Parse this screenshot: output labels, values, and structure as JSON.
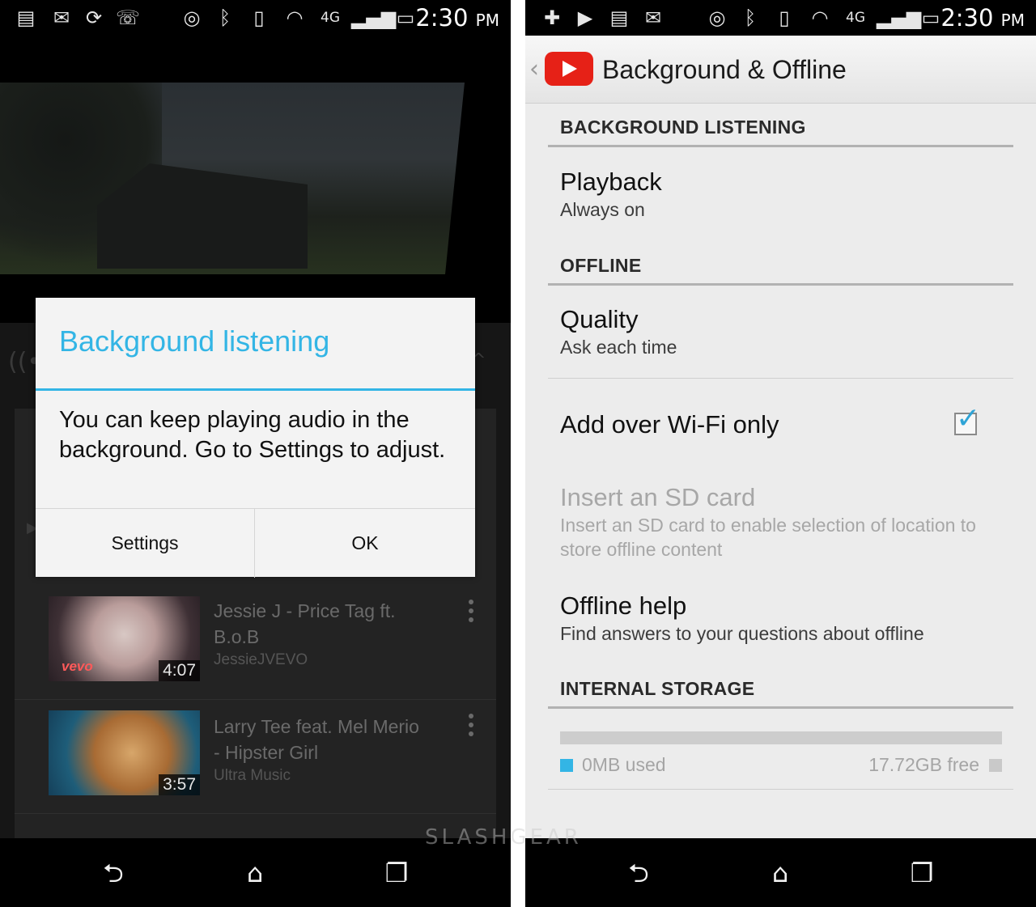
{
  "status_bar_left": {
    "time": "2:30",
    "ampm": "PM",
    "network": "4G"
  },
  "status_bar_right": {
    "time": "2:30",
    "ampm": "PM",
    "network": "4G"
  },
  "dialog": {
    "title": "Background listening",
    "message": "You can keep playing audio in the background. Go to Settings to adjust.",
    "settings_button": "Settings",
    "ok_button": "OK"
  },
  "video_list": [
    {
      "title": "Jessie J - Price Tag ft. B.o.B",
      "channel": "JessieJVEVO",
      "duration": "4:07",
      "badge": "vevo"
    },
    {
      "title": "Larry Tee feat. Mel Merio - Hipster Girl",
      "channel": "Ultra Music",
      "duration": "3:57"
    }
  ],
  "settings": {
    "title": "Background & Offline",
    "background_listening_header": "BACKGROUND LISTENING",
    "playback": {
      "title": "Playback",
      "summary": "Always on"
    },
    "offline_header": "OFFLINE",
    "quality": {
      "title": "Quality",
      "summary": "Ask each time"
    },
    "wifi_only": {
      "title": "Add over Wi-Fi only",
      "checked": true
    },
    "sd_card": {
      "title": "Insert an SD card",
      "summary": "Insert an SD card to enable selection of location to store offline content"
    },
    "offline_help": {
      "title": "Offline help",
      "summary": "Find answers to your questions about offline"
    },
    "internal_storage_header": "INTERNAL STORAGE",
    "storage_used": "0MB used",
    "storage_free": "17.72GB free",
    "storage_used_fraction": 0
  },
  "watermark": "SLASHGEAR",
  "colors": {
    "accent_holo_blue": "#33b5e5",
    "youtube_red": "#e62117",
    "checkbox_blue": "#2fa4d6"
  },
  "icons": {
    "nav": [
      "back-icon",
      "home-icon",
      "recent-apps-icon"
    ],
    "status_left": [
      "gallery-icon",
      "gmail-icon",
      "sync-icon",
      "missed-call-icon"
    ],
    "status_right": [
      "add-icon",
      "youtube-icon",
      "gallery-icon",
      "gmail-icon"
    ]
  }
}
